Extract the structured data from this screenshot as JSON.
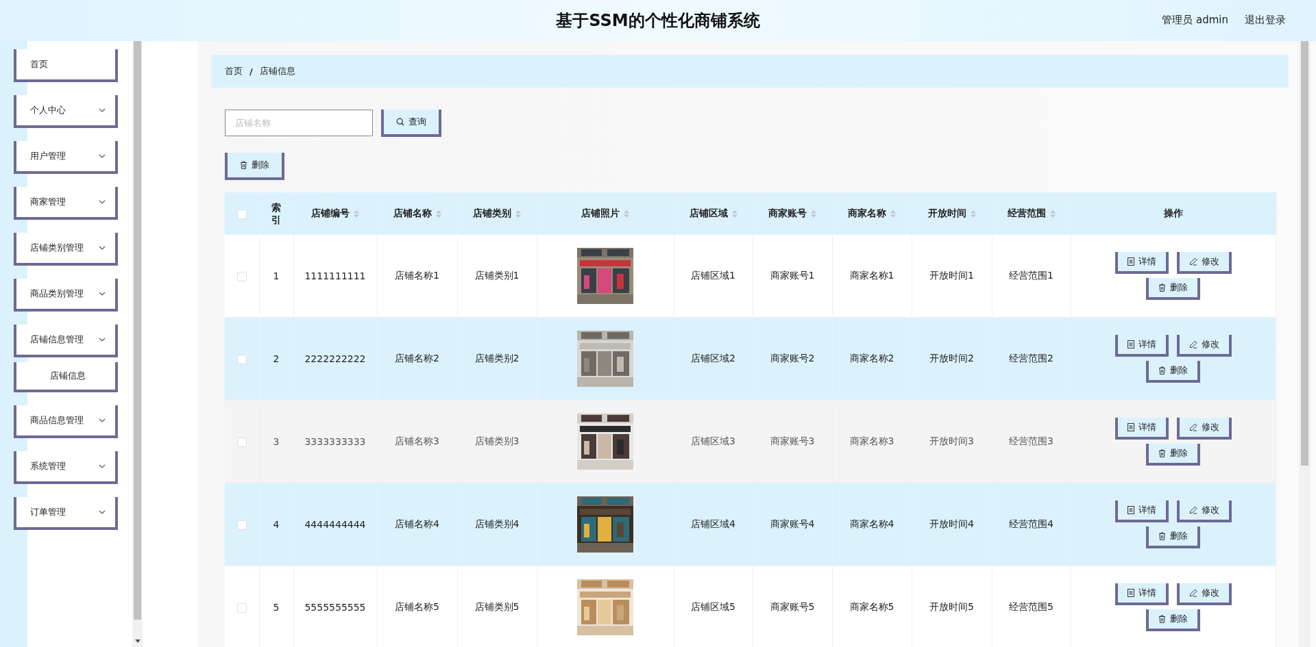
{
  "header": {
    "title": "基于SSM的个性化商铺系统",
    "user": "管理员 admin",
    "logout": "退出登录"
  },
  "sidebar": {
    "items": [
      {
        "kind": "link",
        "label": "首页"
      },
      {
        "kind": "menu",
        "label": "个人中心"
      },
      {
        "kind": "menu",
        "label": "用户管理"
      },
      {
        "kind": "menu",
        "label": "商家管理"
      },
      {
        "kind": "menu",
        "label": "店铺类别管理"
      },
      {
        "kind": "menu",
        "label": "商品类别管理"
      },
      {
        "kind": "menu",
        "label": "店铺信息管理",
        "expanded": true,
        "children": [
          {
            "label": "店铺信息"
          }
        ]
      },
      {
        "kind": "menu",
        "label": "商品信息管理"
      },
      {
        "kind": "menu",
        "label": "系统管理"
      },
      {
        "kind": "menu",
        "label": "订单管理"
      }
    ]
  },
  "breadcrumb": {
    "items": [
      "首页",
      "店铺信息"
    ],
    "separator": "/"
  },
  "search": {
    "placeholder": "店铺名称",
    "button": "查询"
  },
  "toolbar": {
    "delete_button": "删除"
  },
  "table": {
    "header_checked": false,
    "columns": [
      {
        "label": "索引"
      },
      {
        "label": "店铺编号",
        "sortable": true
      },
      {
        "label": "店铺名称",
        "sortable": true
      },
      {
        "label": "店铺类别",
        "sortable": true
      },
      {
        "label": "店铺照片",
        "sortable": true
      },
      {
        "label": "店铺区域",
        "sortable": true
      },
      {
        "label": "商家账号",
        "sortable": true
      },
      {
        "label": "商家名称",
        "sortable": true
      },
      {
        "label": "开放时间",
        "sortable": true
      },
      {
        "label": "经营范围",
        "sortable": true
      },
      {
        "label": "操作"
      }
    ],
    "rows": [
      {
        "checked": false,
        "hovered": false,
        "cells": [
          "1",
          "1111111111",
          "店铺名称1",
          "店铺类别1",
          {
            "kind": "picture"
          },
          "店铺区域1",
          "商家账号1",
          "商家名称1",
          "开放时间1",
          "经营范围1"
        ],
        "actions": [
          "详情",
          "修改",
          "删除"
        ]
      },
      {
        "checked": false,
        "hovered": false,
        "cells": [
          "2",
          "2222222222",
          "店铺名称2",
          "店铺类别2",
          {
            "kind": "picture"
          },
          "店铺区域2",
          "商家账号2",
          "商家名称2",
          "开放时间2",
          "经营范围2"
        ],
        "actions": [
          "详情",
          "修改",
          "删除"
        ]
      },
      {
        "checked": false,
        "hovered": true,
        "cells": [
          "3",
          "3333333333",
          "店铺名称3",
          "店铺类别3",
          {
            "kind": "picture"
          },
          "店铺区域3",
          "商家账号3",
          "商家名称3",
          "开放时间3",
          "经营范围3"
        ],
        "actions": [
          "详情",
          "修改",
          "删除"
        ]
      },
      {
        "checked": false,
        "hovered": false,
        "cells": [
          "4",
          "4444444444",
          "店铺名称4",
          "店铺类别4",
          {
            "kind": "picture"
          },
          "店铺区域4",
          "商家账号4",
          "商家名称4",
          "开放时间4",
          "经营范围4"
        ],
        "actions": [
          "详情",
          "修改",
          "删除"
        ]
      },
      {
        "checked": false,
        "hovered": false,
        "cells": [
          "5",
          "5555555555",
          "店铺名称5",
          "店铺类别5",
          {
            "kind": "picture"
          },
          "店铺区域5",
          "商家账号5",
          "商家名称5",
          "开放时间5",
          "经营范围5"
        ],
        "actions": [
          "详情",
          "修改",
          "删除"
        ]
      }
    ]
  }
}
